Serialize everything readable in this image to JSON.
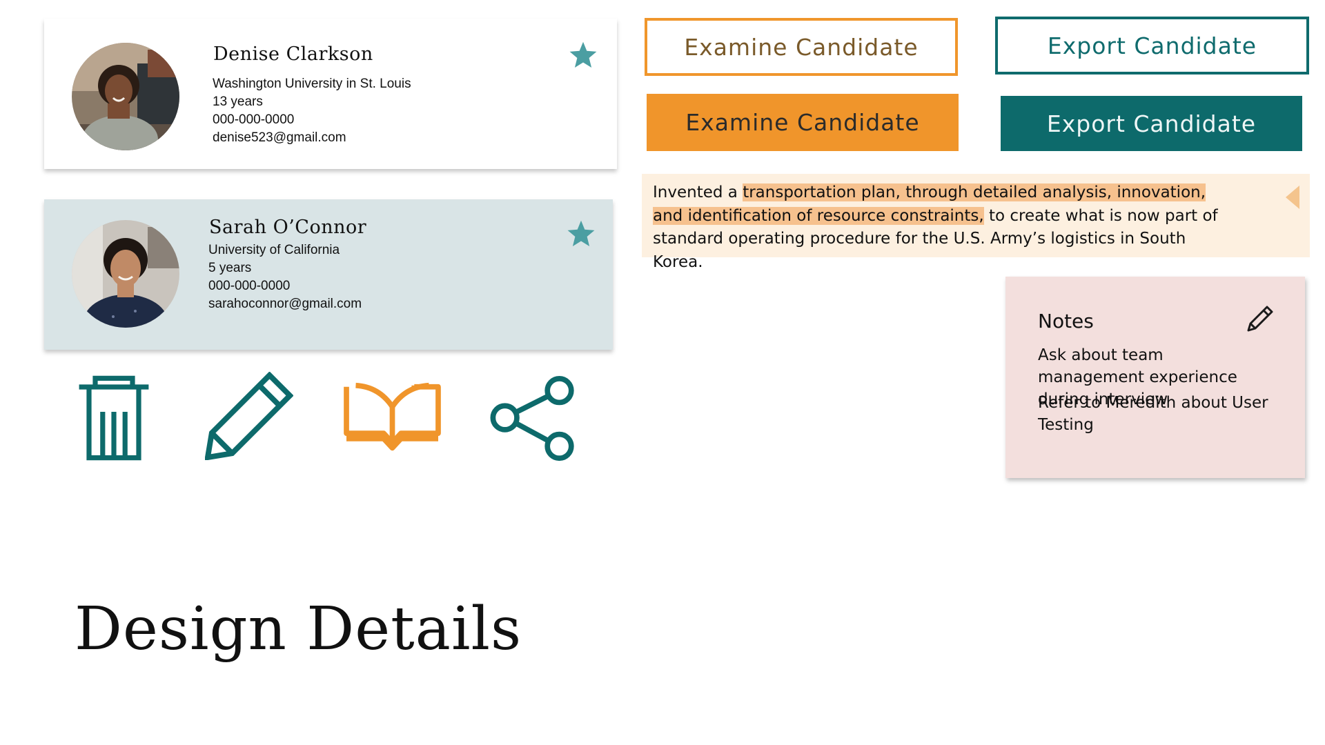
{
  "candidates": [
    {
      "name": "Denise Clarkson",
      "school": "Washington University in St. Louis",
      "experience": "13 years",
      "phone": "000-000-0000",
      "email": "denise523@gmail.com",
      "favorited": true
    },
    {
      "name": "Sarah O’Connor",
      "school": "University of California",
      "experience": "5 years",
      "phone": "000-000-0000",
      "email": "sarahoconnor@gmail.com",
      "favorited": true
    }
  ],
  "buttons": {
    "examine_outline": "Examine Candidate",
    "export_outline": "Export Candidate",
    "examine_solid": "Examine Candidate",
    "export_solid": "Export Candidate"
  },
  "icons": [
    "trash-icon",
    "pencil-icon",
    "book-icon",
    "share-icon",
    "star-icon",
    "edit-icon"
  ],
  "highlight": {
    "prefix": "Invented a ",
    "marked": "transportation plan, through detailed analysis, innovation, and identification of resource constraints,",
    "suffix": " to create what is now part of standard operating procedure for the U.S. Army’s logistics in South Korea."
  },
  "notes": {
    "title": "Notes",
    "items": [
      "Ask about team management experience during interview",
      "Refer to Meredith about User Testing"
    ]
  },
  "page_title": "Design Details",
  "colors": {
    "teal": "#0d6a6b",
    "orange": "#f0952b",
    "card_blue": "#d9e4e6",
    "highlight_bg": "#fdf0e0",
    "highlight_mark": "#f6c18e",
    "notes_bg": "#f3dfdd",
    "star": "#4b9ea2"
  }
}
